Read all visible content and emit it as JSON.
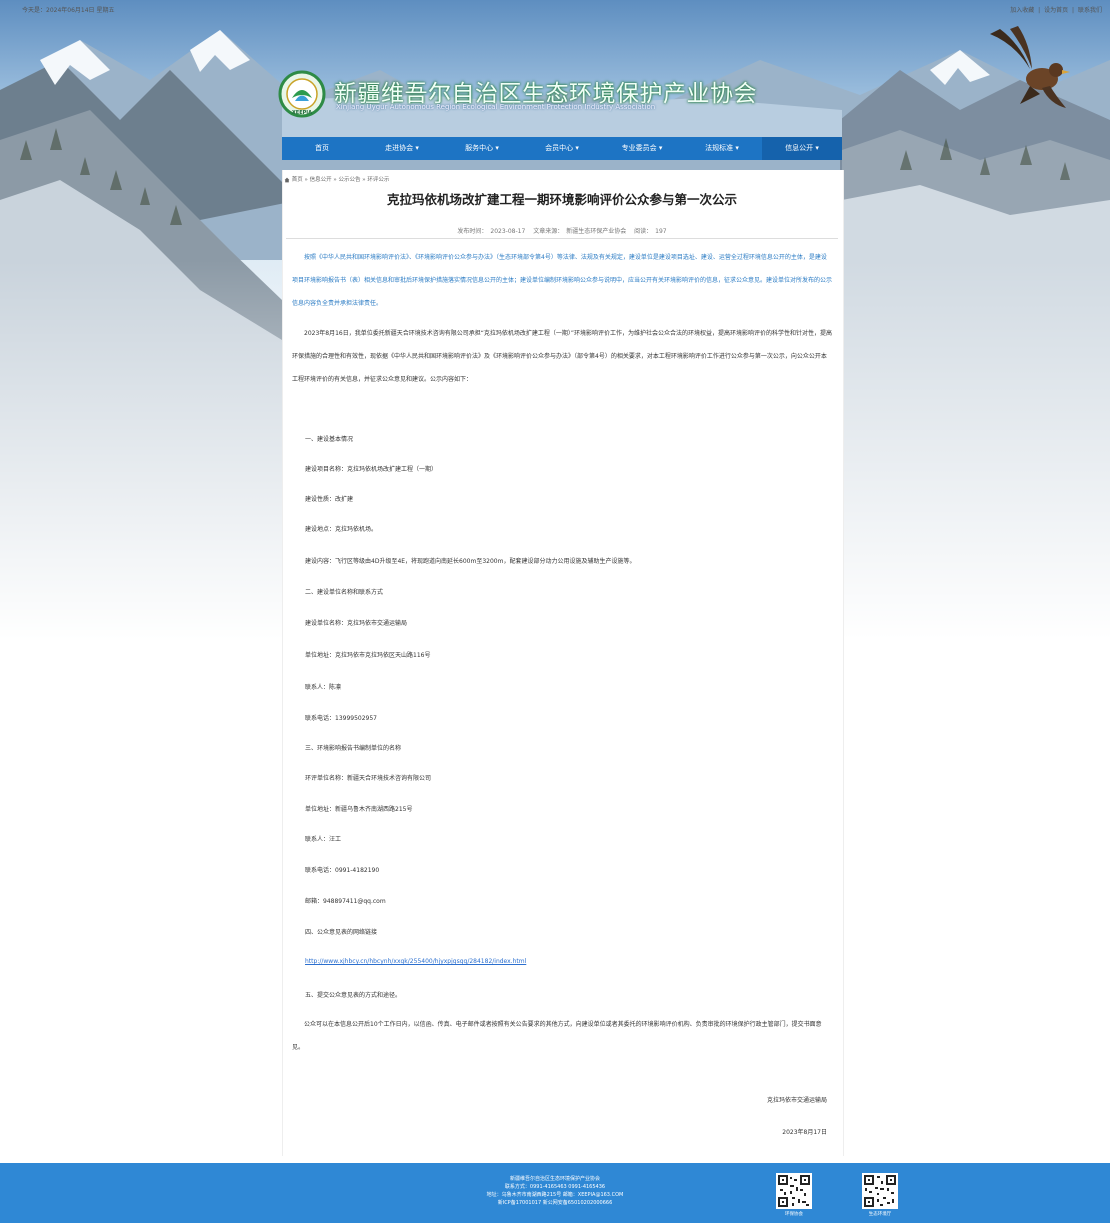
{
  "topbar": {
    "date_text": "今天是：2024年06月14日 星期五",
    "links": [
      "加入收藏",
      "|",
      "设为首页",
      "|",
      "联系我们"
    ]
  },
  "header": {
    "site_title": "新疆维吾尔自治区生态环境保护产业协会",
    "site_subtitle": "Xinjiang Uygur Autonomous Region Ecological Environment Protection Industry Association",
    "logo_text": "XEEPIA"
  },
  "nav": {
    "items": [
      "首页",
      "走进协会 ▾",
      "服务中心 ▾",
      "会员中心 ▾",
      "专业委员会 ▾",
      "法规标准 ▾",
      "信息公开 ▾"
    ]
  },
  "breadcrumb": "首页 » 信息公开 » 公示公告 » 环评公示",
  "article": {
    "title": "克拉玛依机场改扩建工程一期环境影响评价公众参与第一次公示",
    "meta": {
      "publish_label": "发布时间：",
      "publish_date": "2023-08-17",
      "source_label": "文章来源：",
      "source": "新疆生态环保产业协会",
      "views_label": "阅读：",
      "views": "197"
    },
    "notice": "按照《中华人民共和国环境影响评价法》、《环境影响评价公众参与办法》（生态环境部令第4号）等法律、法规及有关规定，建设单位是建设项目选址、建设、运营全过程环境信息公开的主体，是建设项目环境影响报告书（表）相关信息和审批后环境保护措施落实情况信息公开的主体；建设单位编制环境影响公众参与说明中，应当公开有关环境影响评价的信息，征求公众意见。建设单位对所发布的公示信息内容负全责并承担法律责任。",
    "intro": "2023年8月16日，我单位委托新疆天合环境技术咨询有限公司承担“克拉玛依机场改扩建工程（一期）”环境影响评价工作，为维护社会公众合法的环境权益，提高环境影响评价的科学性和针对性，提高环保措施的合理性和有效性，现依据《中华人民共和国环境影响评价法》及《环境影响评价公众参与办法》（部令第4号）的相关要求，对本工程环境影响评价工作进行公众参与第一次公示，向公众公开本工程环境评价的有关信息，并征求公众意见和建议。公示内容如下：",
    "lines": [
      "一、建设基本情况",
      "建设项目名称：克拉玛依机场改扩建工程（一期）",
      "建设性质：改扩建",
      "建设地点：克拉玛依机场。",
      "建设内容：飞行区等级由4D升级至4E，将现跑道向南延长600m至3200m，配套建设部分动力公用设施及辅助生产设施等。",
      "二、建设单位名称和联系方式",
      "建设单位名称：克拉玛依市交通运输局",
      "单位地址：克拉玛依市克拉玛依区天山路116号",
      "联系人：陈凛",
      "联系电话：13999502957",
      "三、环境影响报告书编制单位的名称",
      "环评单位名称：新疆天合环境技术咨询有限公司",
      "单位地址：新疆乌鲁木齐南湖西路215号",
      "联系人：汪工",
      "联系电话：0991-4182190",
      "邮箱：948897411@qq.com",
      "四、公众意见表的网络链接",
      "http://www.xjhbcy.cn/hbcynh/xxgk/255400/hjyxpjgsgg/284182/index.html",
      "五、提交公众意见表的方式和途径。"
    ],
    "closing": "公众可以在本信息公开后10个工作日内，以信函、传真、电子邮件或者按照有关公告要求的其他方式，向建设单位或者其委托的环境影响评价机构、负责审批的环境保护行政主管部门，提交书面意见。",
    "signature": "克拉玛依市交通运输局",
    "sign_date": "2023年8月17日"
  },
  "footer": {
    "lines": [
      "新疆维吾尔自治区生态环境保护产业协会",
      "联系方式：0991-4165463 0991-4165436",
      "地址：乌鲁木齐市南湖西路215号 邮箱：XEEPIA@163.COM",
      "新ICP备17001017   新公网安备65010202000666"
    ],
    "qr_labels": [
      "环保协会",
      "生态环境厅"
    ]
  }
}
